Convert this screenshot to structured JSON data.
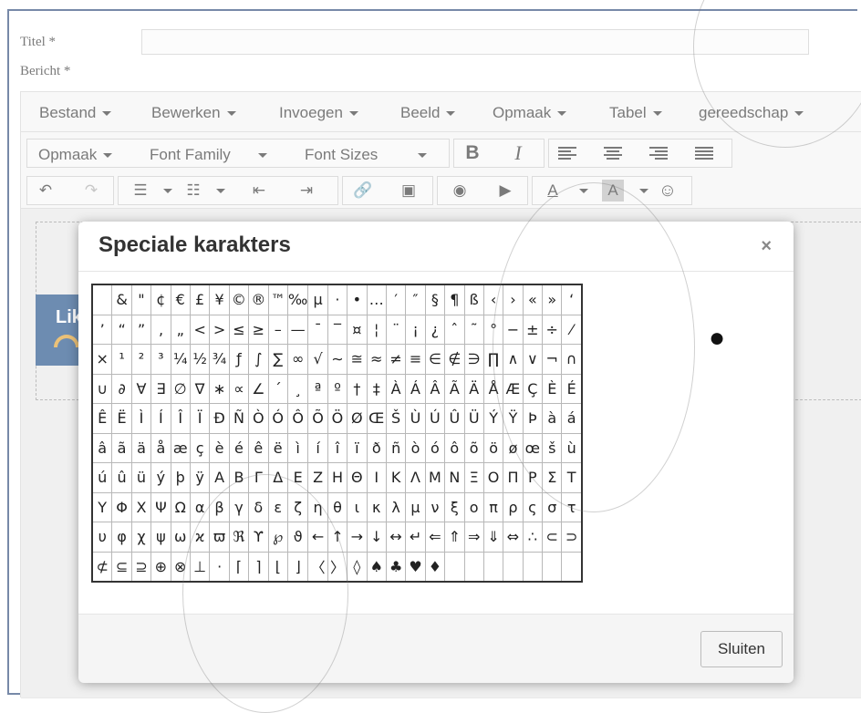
{
  "form": {
    "title_label": "Titel *",
    "message_label": "Bericht *",
    "title_value": ""
  },
  "menubar": [
    "Bestand",
    "Bewerken",
    "Invoegen",
    "Beeld",
    "Opmaak",
    "Tabel",
    "gereedschap"
  ],
  "toolbar1": {
    "format_label": "Opmaak",
    "font_family_label": "Font Family",
    "font_sizes_label": "Font Sizes",
    "bold": "B",
    "italic": "I"
  },
  "toolbar2": {
    "undo": "↶",
    "redo": "↷",
    "bullets": "☰",
    "numbers": "☷",
    "outdent": "⇤",
    "indent": "⇥",
    "link": "🔗",
    "image": "▣",
    "preview": "◉",
    "media": "▶",
    "text_color": "A",
    "bg_color": "A",
    "emoticon": "☺"
  },
  "content": {
    "banner_text": "Lik"
  },
  "modal": {
    "title": "Speciale karakters",
    "close_symbol": "×",
    "close_button": "Sluiten",
    "preview_char": "●",
    "rows": [
      [
        "",
        "&",
        "\"",
        "¢",
        "€",
        "£",
        "¥",
        "©",
        "®",
        "™",
        "‰",
        "µ",
        "·",
        "•",
        "…",
        "′",
        "″",
        "§",
        "¶",
        "ß",
        "‹",
        "›",
        "«",
        "»",
        "‘"
      ],
      [
        "’",
        "“",
        "”",
        "‚",
        "„",
        "<",
        ">",
        "≤",
        "≥",
        "–",
        "—",
        "¯",
        "‾",
        "¤",
        "¦",
        "¨",
        "¡",
        "¿",
        "ˆ",
        "˜",
        "°",
        "−",
        "±",
        "÷",
        "⁄"
      ],
      [
        "×",
        "¹",
        "²",
        "³",
        "¼",
        "½",
        "¾",
        "ƒ",
        "∫",
        "∑",
        "∞",
        "√",
        "∼",
        "≅",
        "≈",
        "≠",
        "≡",
        "∈",
        "∉",
        "∋",
        "∏",
        "∧",
        "∨",
        "¬",
        "∩"
      ],
      [
        "∪",
        "∂",
        "∀",
        "∃",
        "∅",
        "∇",
        "∗",
        "∝",
        "∠",
        "´",
        "¸",
        "ª",
        "º",
        "†",
        "‡",
        "À",
        "Á",
        "Â",
        "Ã",
        "Ä",
        "Å",
        "Æ",
        "Ç",
        "È",
        "É"
      ],
      [
        "Ê",
        "Ë",
        "Ì",
        "Í",
        "Î",
        "Ï",
        "Ð",
        "Ñ",
        "Ò",
        "Ó",
        "Ô",
        "Õ",
        "Ö",
        "Ø",
        "Œ",
        "Š",
        "Ù",
        "Ú",
        "Û",
        "Ü",
        "Ý",
        "Ÿ",
        "Þ",
        "à",
        "á"
      ],
      [
        "â",
        "ã",
        "ä",
        "å",
        "æ",
        "ç",
        "è",
        "é",
        "ê",
        "ë",
        "ì",
        "í",
        "î",
        "ï",
        "ð",
        "ñ",
        "ò",
        "ó",
        "ô",
        "õ",
        "ö",
        "ø",
        "œ",
        "š",
        "ù"
      ],
      [
        "ú",
        "û",
        "ü",
        "ý",
        "þ",
        "ÿ",
        "Α",
        "Β",
        "Γ",
        "Δ",
        "Ε",
        "Ζ",
        "Η",
        "Θ",
        "Ι",
        "Κ",
        "Λ",
        "Μ",
        "Ν",
        "Ξ",
        "Ο",
        "Π",
        "Ρ",
        "Σ",
        "Τ"
      ],
      [
        "Υ",
        "Φ",
        "Χ",
        "Ψ",
        "Ω",
        "α",
        "β",
        "γ",
        "δ",
        "ε",
        "ζ",
        "η",
        "θ",
        "ι",
        "κ",
        "λ",
        "μ",
        "ν",
        "ξ",
        "ο",
        "π",
        "ρ",
        "ς",
        "σ",
        "τ"
      ],
      [
        "υ",
        "φ",
        "χ",
        "ψ",
        "ω",
        "ϰ",
        "ϖ",
        "ℜ",
        "ϒ",
        "℘",
        "ϑ",
        "←",
        "↑",
        "→",
        "↓",
        "↔",
        "↵",
        "⇐",
        "⇑",
        "⇒",
        "⇓",
        "⇔",
        "∴",
        "⊂",
        "⊃"
      ],
      [
        "⊄",
        "⊆",
        "⊇",
        "⊕",
        "⊗",
        "⊥",
        "⋅",
        "⌈",
        "⌉",
        "⌊",
        "⌋",
        "〈",
        "〉",
        "◊",
        "♠",
        "♣",
        "♥",
        "♦",
        "",
        "",
        "",
        "",
        "",
        "",
        ""
      ]
    ]
  }
}
